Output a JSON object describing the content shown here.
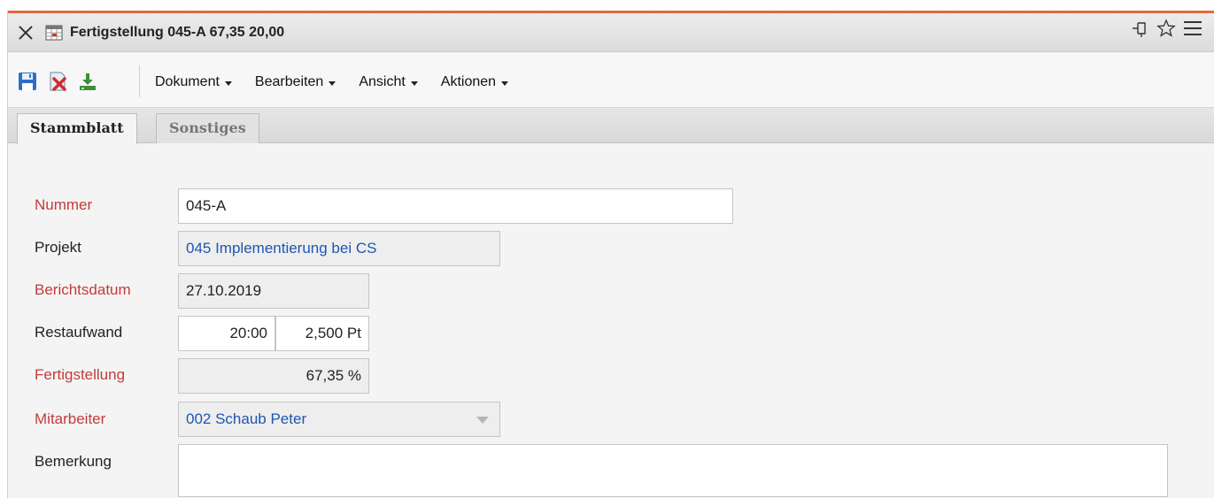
{
  "window": {
    "title": "Fertigstellung 045-A 67,35 20,00",
    "icons": [
      "close-icon",
      "document-icon",
      "pin-icon",
      "star-icon",
      "menu-icon"
    ]
  },
  "toolbar": {
    "icons": [
      "save-icon",
      "delete-icon",
      "download-icon"
    ],
    "menus": [
      "Dokument",
      "Bearbeiten",
      "Ansicht",
      "Aktionen"
    ]
  },
  "tabs": [
    {
      "label": "Stammblatt",
      "active": true
    },
    {
      "label": "Sonstiges",
      "active": false
    }
  ],
  "form": {
    "nummer": {
      "label": "Nummer",
      "value": "045-A"
    },
    "projekt": {
      "label": "Projekt",
      "value": "045 Implementierung bei CS"
    },
    "berichtsdatum": {
      "label": "Berichtsdatum",
      "value": "27.10.2019"
    },
    "restaufwand": {
      "label": "Restaufwand",
      "hours": "20:00",
      "days": "2,500 Pt"
    },
    "fertigstellung": {
      "label": "Fertigstellung",
      "value": "67,35 %"
    },
    "mitarbeiter": {
      "label": "Mitarbeiter",
      "value": "002 Schaub Peter"
    },
    "bemerkung": {
      "label": "Bemerkung",
      "value": ""
    }
  },
  "colors": {
    "accent": "#e2683f",
    "required_label": "#c43b3b",
    "link": "#1e56b0"
  }
}
